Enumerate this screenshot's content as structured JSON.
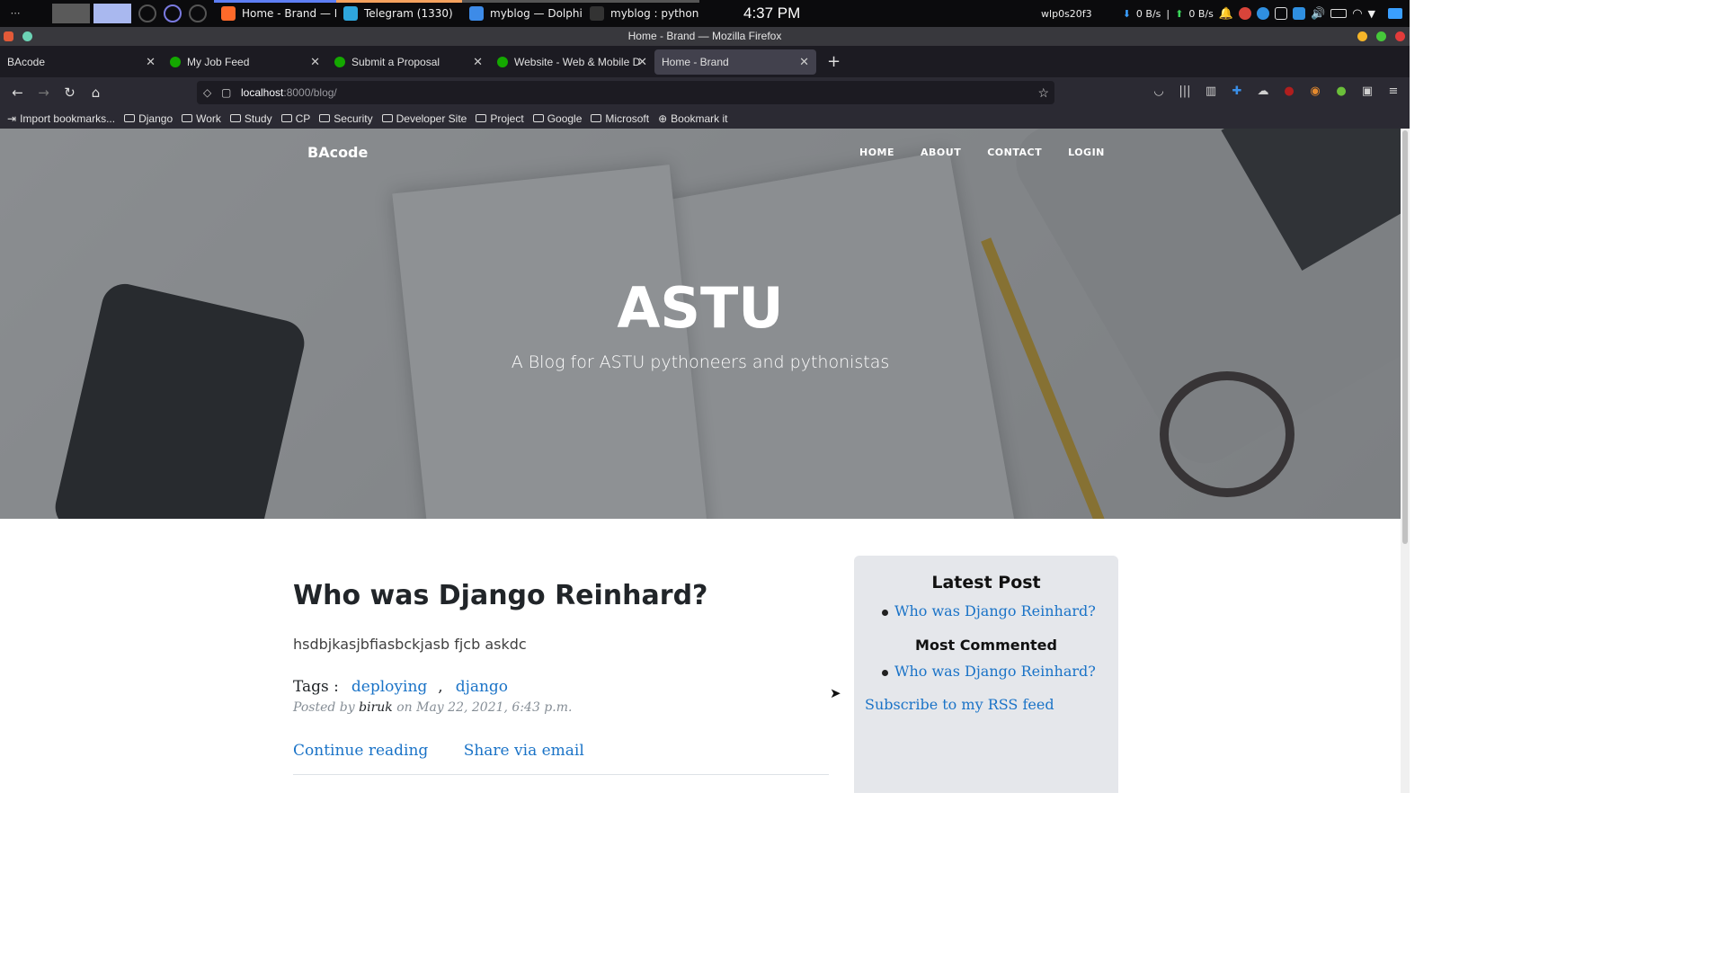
{
  "system": {
    "tasks": [
      {
        "label": "Home - Brand — Mo...",
        "line": "#5e7ff5",
        "icon": "#ff6a2a"
      },
      {
        "label": "Telegram (1330)",
        "line": "#f5a25e",
        "icon": "#2ea6dd",
        "badge": "1330"
      },
      {
        "label": "myblog — Dolphin",
        "line": "#555",
        "icon": "#3d8be8"
      },
      {
        "label": "myblog : python —",
        "line": "#555",
        "icon": "#333"
      }
    ],
    "clock": "4:37 PM",
    "network_iface": "wlp0s20f3",
    "net_down": "0 B/s",
    "net_sep": "|",
    "net_up": "0 B/s"
  },
  "browser": {
    "window_title": "Home - Brand — Mozilla Firefox",
    "tabs": [
      {
        "label": "BAcode",
        "favicon": false,
        "active": false
      },
      {
        "label": "My Job Feed",
        "favicon": true,
        "active": false
      },
      {
        "label": "Submit a Proposal",
        "favicon": true,
        "active": false
      },
      {
        "label": "Website - Web & Mobile D",
        "favicon": true,
        "active": false
      },
      {
        "label": "Home - Brand",
        "favicon": false,
        "active": true
      }
    ],
    "url_host": "localhost",
    "url_path": ":8000/blog/",
    "bookmarks": [
      {
        "label": "Import bookmarks...",
        "kind": "import"
      },
      {
        "label": "Django",
        "kind": "folder"
      },
      {
        "label": "Work",
        "kind": "folder"
      },
      {
        "label": "Study",
        "kind": "folder"
      },
      {
        "label": "CP",
        "kind": "folder"
      },
      {
        "label": "Security",
        "kind": "folder"
      },
      {
        "label": "Developer Site",
        "kind": "folder"
      },
      {
        "label": "Project",
        "kind": "folder"
      },
      {
        "label": "Google",
        "kind": "folder"
      },
      {
        "label": "Microsoft",
        "kind": "folder"
      },
      {
        "label": "Bookmark it",
        "kind": "globe"
      }
    ]
  },
  "site": {
    "brand": "BAcode",
    "nav": [
      "HOME",
      "ABOUT",
      "CONTACT",
      "LOGIN"
    ],
    "hero_title": "ASTU",
    "hero_subtitle": "A Blog for ASTU pythoneers and pythonistas"
  },
  "post": {
    "title": "Who was Django Reinhard?",
    "body": "hsdbjkasjbfiasbckjasb fjcb askdc",
    "tags_label": "Tags :",
    "tags": [
      "deploying",
      "django"
    ],
    "tag_separator": ",",
    "posted_by_prefix": "Posted by",
    "author": "biruk",
    "date_prefix": "on",
    "date": "May 22, 2021, 6:43 p.m.",
    "continue_label": "Continue reading",
    "share_label": "Share via email"
  },
  "sidebar": {
    "latest_heading": "Latest Post",
    "latest_items": [
      "Who was Django Reinhard?"
    ],
    "most_commented_heading": "Most Commented",
    "most_commented_items": [
      "Who was Django Reinhard?"
    ],
    "rss_label": "Subscribe to my RSS feed"
  },
  "colors": {
    "link": "#1a73c7",
    "heading": "#212529",
    "sidebar_bg": "#e5e7eb",
    "browser_chrome": "#2b2a33"
  }
}
